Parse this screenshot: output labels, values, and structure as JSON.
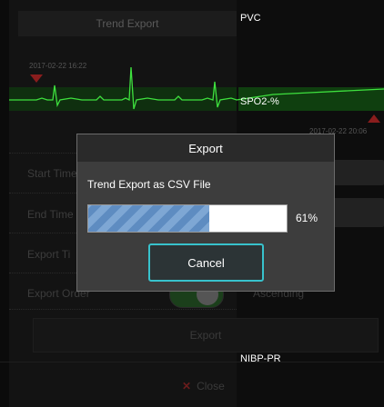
{
  "background": {
    "window_title": "Trend Export",
    "start_timestamp": "2017-02-22 16:22",
    "end_timestamp": "2017-02-22 20:06",
    "rows": [
      {
        "label": "Start Time"
      },
      {
        "label": "End Time"
      },
      {
        "label": "Export Ti"
      },
      {
        "label": "Export Order"
      }
    ],
    "order_value": "Ascending",
    "export_label": "Export",
    "close_label": "Close",
    "params": {
      "pvc": "PVC",
      "spo2": "SPO2-%",
      "nibp_pr": "NIBP-PR"
    }
  },
  "dialog": {
    "title": "Export",
    "message": "Trend Export as CSV File",
    "progress": 0.61,
    "progress_text": "61%",
    "cancel_label": "Cancel"
  }
}
